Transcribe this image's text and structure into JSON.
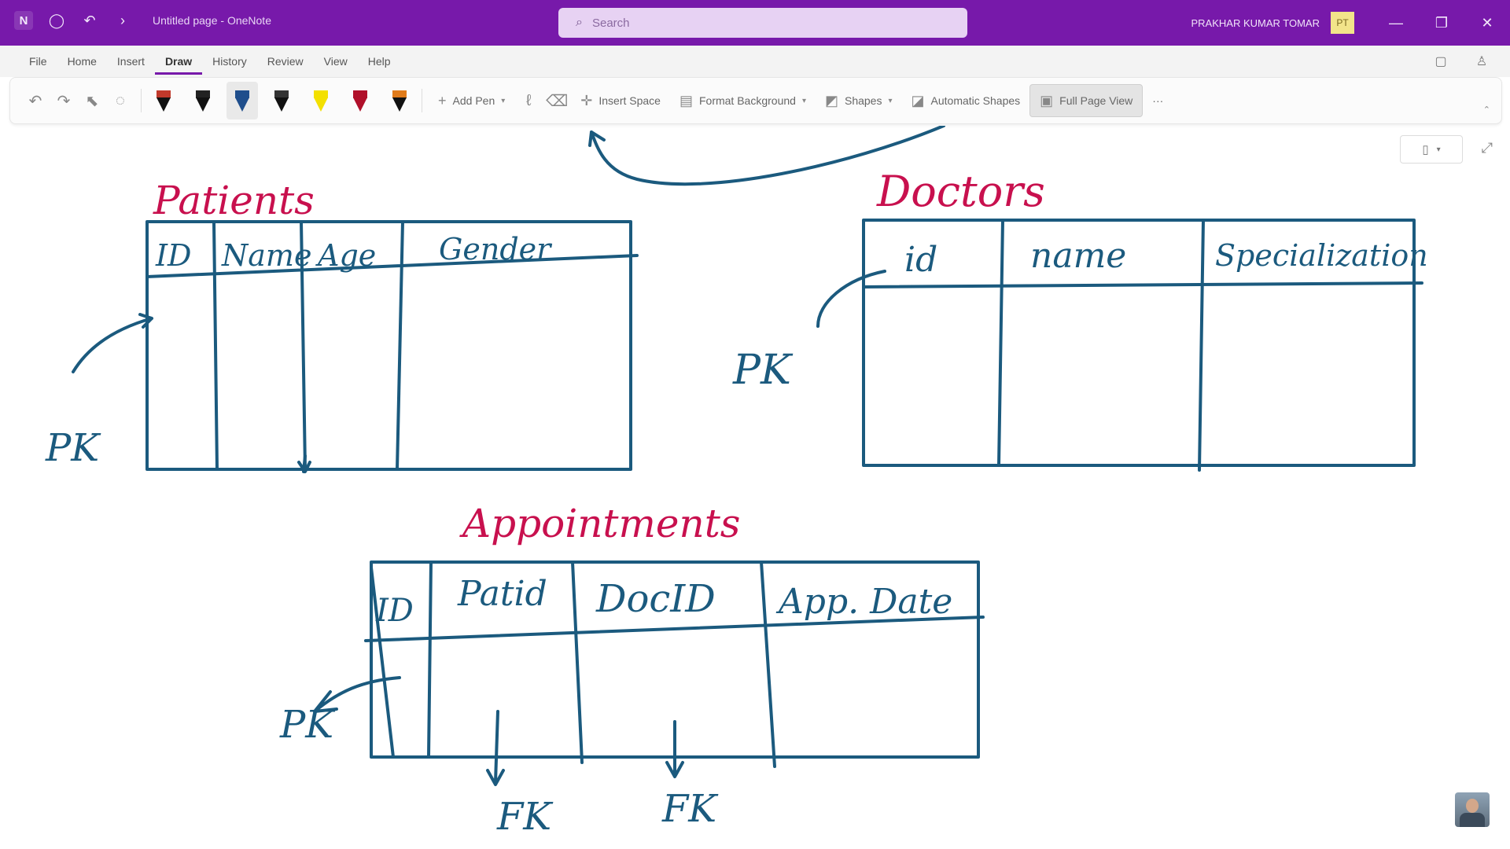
{
  "titlebar": {
    "app_icon": "onenote-logo",
    "doc_title": "Untitled page - OneNote",
    "search_placeholder": "Search",
    "user_name": "PRAKHAR KUMAR TOMAR",
    "user_initials": "PT",
    "buttons": {
      "minimize": "—",
      "maximize": "❐",
      "close": "✕"
    }
  },
  "menu": {
    "tabs": [
      "File",
      "Home",
      "Insert",
      "Draw",
      "History",
      "Review",
      "View",
      "Help"
    ],
    "active": "Draw"
  },
  "ribbon": {
    "pens": [
      {
        "color": "#111111",
        "band": "#c0392b"
      },
      {
        "color": "#111111",
        "band": "#222222"
      },
      {
        "color": "#1f4e8c",
        "band": "#1f4e8c",
        "selected": true
      },
      {
        "color": "#111111",
        "band": "#333333"
      },
      {
        "color": "#f3e000",
        "band": "#f3e000"
      },
      {
        "color": "#b0102a",
        "band": "#b0102a"
      },
      {
        "color": "#111111",
        "band": "#e07b1a"
      }
    ],
    "add_pen": "Add Pen",
    "insert_space": "Insert Space",
    "format_background": "Format Background",
    "shapes": "Shapes",
    "automatic_shapes": "Automatic Shapes",
    "full_page_view": "Full Page View",
    "more": "···"
  },
  "canvas": {
    "tables": {
      "patients": {
        "title": "Patients",
        "columns": [
          "ID",
          "Name",
          "Age",
          "Gender"
        ],
        "pk_label": "PK"
      },
      "doctors": {
        "title": "Doctors",
        "columns": [
          "id",
          "name",
          "Specialization"
        ],
        "pk_label": "PK"
      },
      "appointments": {
        "title": "Appointments",
        "columns": [
          "ID",
          "Patid",
          "DocID",
          "App. Date"
        ],
        "pk_label": "PK",
        "fk_labels": [
          "FK",
          "FK"
        ]
      }
    }
  }
}
